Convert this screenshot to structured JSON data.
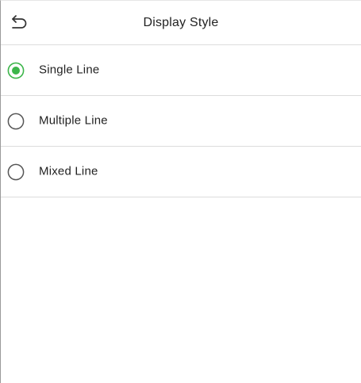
{
  "header": {
    "title": "Display Style",
    "back_icon": "back-arrow-icon"
  },
  "options": [
    {
      "label": "Single Line",
      "selected": true
    },
    {
      "label": "Multiple Line",
      "selected": false
    },
    {
      "label": "Mixed Line",
      "selected": false
    }
  ],
  "colors": {
    "accent": "#3cb54a",
    "radio_border": "#555555",
    "divider": "#dcdcdc"
  }
}
